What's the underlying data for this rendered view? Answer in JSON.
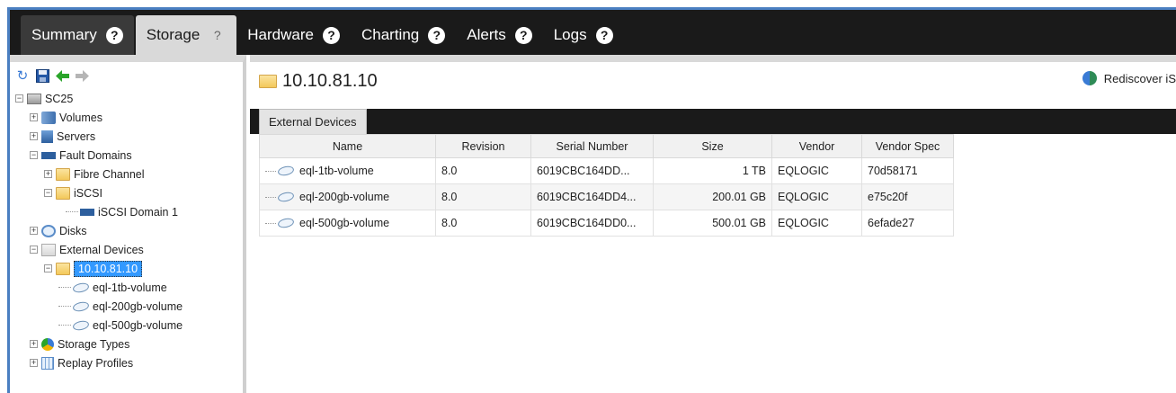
{
  "tabs": [
    {
      "label": "Summary",
      "help": "?"
    },
    {
      "label": "Storage",
      "help": "?"
    },
    {
      "label": "Hardware",
      "help": "?"
    },
    {
      "label": "Charting",
      "help": "?"
    },
    {
      "label": "Alerts",
      "help": "?"
    },
    {
      "label": "Logs",
      "help": "?"
    }
  ],
  "toolbar": {
    "icons": [
      "refresh-icon",
      "save-icon",
      "back-arrow-icon",
      "forward-arrow-icon"
    ]
  },
  "tree": {
    "root": "SC25",
    "volumes": "Volumes",
    "servers": "Servers",
    "fault_domains": "Fault Domains",
    "fibre_channel": "Fibre Channel",
    "iscsi": "iSCSI",
    "iscsi_domain": "iSCSI Domain 1",
    "disks": "Disks",
    "external_devices": "External Devices",
    "device_ip": "10.10.81.10",
    "vol1": "eql-1tb-volume",
    "vol2": "eql-200gb-volume",
    "vol3": "eql-500gb-volume",
    "storage_types": "Storage Types",
    "replay_profiles": "Replay Profiles"
  },
  "main": {
    "title": "10.10.81.10",
    "rediscover_label": "Rediscover iS",
    "subtab": "External Devices",
    "columns": [
      "Name",
      "Revision",
      "Serial Number",
      "Size",
      "Vendor",
      "Vendor Spec"
    ],
    "rows": [
      {
        "name": "eql-1tb-volume",
        "revision": "8.0",
        "serial": "6019CBC164DD...",
        "size": "1 TB",
        "vendor": "EQLOGIC",
        "vendor_spec": "70d58171"
      },
      {
        "name": "eql-200gb-volume",
        "revision": "8.0",
        "serial": "6019CBC164DD4...",
        "size": "200.01 GB",
        "vendor": "EQLOGIC",
        "vendor_spec": "e75c20f"
      },
      {
        "name": "eql-500gb-volume",
        "revision": "8.0",
        "serial": "6019CBC164DD0...",
        "size": "500.01 GB",
        "vendor": "EQLOGIC",
        "vendor_spec": "6efade27"
      }
    ]
  },
  "colors": {
    "tabbar_bg": "#1a1a1a",
    "selection": "#3399ff",
    "frame_accent": "#4a7fc1"
  }
}
